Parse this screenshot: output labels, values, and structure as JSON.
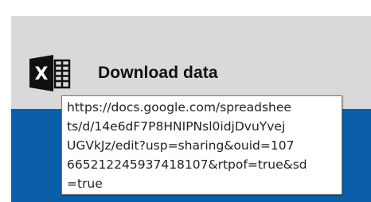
{
  "download": {
    "label": "Download data",
    "icon": "excel-icon",
    "icon_letter": "X"
  },
  "tooltip": {
    "url_lines": [
      "https://docs.google.com/spreadshee",
      "ts/d/14e6dF7P8HNIPNsl0idjDvuYvej",
      "UGVkJz/edit?usp=sharing&ouid=107",
      "665212245937418107&rtpof=true&sd",
      "=true"
    ]
  },
  "colors": {
    "panel": "#d9d9d9",
    "band": "#0b5ea8",
    "icon": "#111111"
  }
}
